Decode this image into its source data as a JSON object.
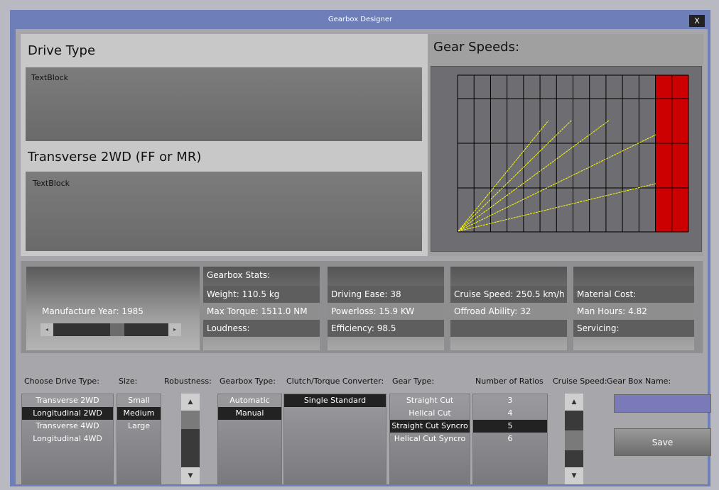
{
  "window": {
    "title": "Gearbox Designer",
    "close_label": "X"
  },
  "drive_panel": {
    "heading": "Drive Type",
    "textblock1": "TextBlock",
    "subheading": "Transverse 2WD (FF or MR)",
    "textblock2": "TextBlock"
  },
  "gear_speeds": {
    "title": "Gear Speeds:"
  },
  "chart_data": {
    "type": "line",
    "title": "",
    "grid": true,
    "redline": true,
    "colors": {
      "background": "#6e6e72",
      "grid": "#000000",
      "line": "#ffff00",
      "redline": "#cc0000"
    }
  },
  "manufacture": {
    "label": "Manufacture Year: 1985",
    "year": 1985
  },
  "stats": {
    "col1": {
      "header": "Gearbox Stats:",
      "weight": "Weight: 110.5 kg",
      "torque": "Max Torque: 1511.0 NM",
      "loudness": "Loudness:"
    },
    "col2": {
      "driving_ease": "Driving Ease: 38",
      "powerloss": "Powerloss: 15.9 KW",
      "efficiency": "Efficiency: 98.5"
    },
    "col3": {
      "cruise": "Cruise Speed: 250.5 km/h",
      "offroad": "Offroad Ability: 32"
    },
    "col4": {
      "material": "Material Cost:",
      "hours": "Man Hours: 4.82",
      "servicing": "Servicing:"
    }
  },
  "labels": {
    "drive_type": "Choose Drive Type:",
    "size": "Size:",
    "robustness": "Robustness:",
    "gearbox_type": "Gearbox Type:",
    "clutch": "Clutch/Torque Converter:",
    "gear_type": "Gear Type:",
    "ratios": "Number of Ratios",
    "cruise_speed": "Cruise Speed:",
    "name": "Gear Box Name:"
  },
  "lists": {
    "drive_types": [
      "Transverse 2WD",
      "Longitudinal 2WD",
      "Transverse 4WD",
      "Longitudinal 4WD"
    ],
    "sizes": [
      "Small",
      "Medium",
      "Large"
    ],
    "gearbox_types": [
      "Automatic",
      "Manual"
    ],
    "clutches": [
      "Single Standard"
    ],
    "gear_types": [
      "Straight Cut",
      "Helical Cut",
      "Straight Cut Syncro",
      "Helical Cut Syncro"
    ],
    "ratios": [
      "3",
      "4",
      "5",
      "6"
    ]
  },
  "save_label": "Save",
  "arrows": {
    "left": "◂",
    "right": "▸",
    "up": "▲",
    "down": "▼"
  }
}
